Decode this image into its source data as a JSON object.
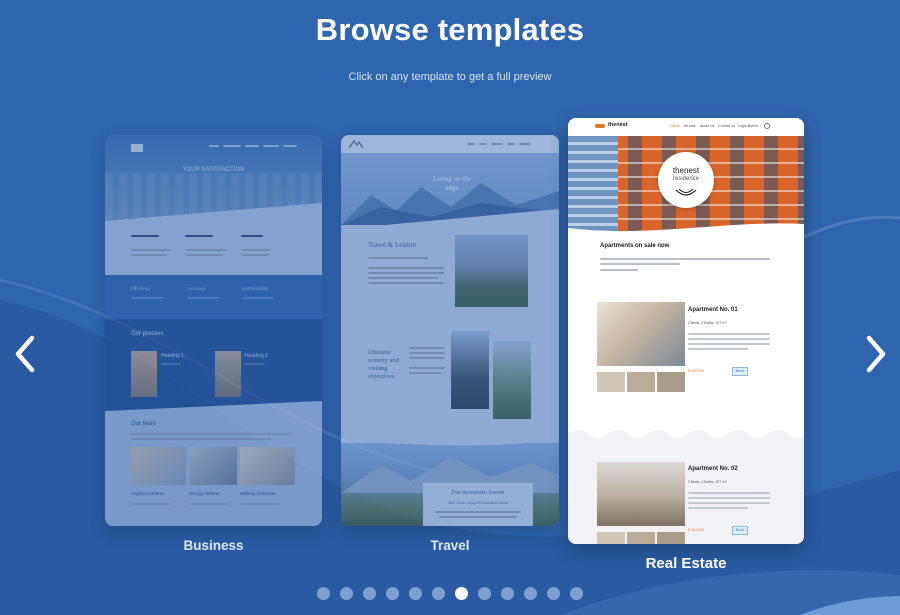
{
  "header": {
    "title": "Browse templates",
    "subtitle": "Click on any template to get a full preview"
  },
  "colors": {
    "background": "#2f64ae",
    "accent": "#ffffff",
    "real_estate_orange": "#e07a2a"
  },
  "navigation": {
    "prev_icon": "chevron-left-icon",
    "next_icon": "chevron-right-icon"
  },
  "templates": [
    {
      "label": "Business",
      "preview": {
        "hero_text": "YOUR SATISFACTION",
        "section_our_process": "Our process",
        "process_items": [
          "Heading 1",
          "Heading 2"
        ],
        "section_our_team": "Our team",
        "team_members": [
          "Sophia Cameron",
          "George Nelson",
          "Melissa Simmons"
        ],
        "info_row": [
          "Efficiency",
          "Accuracy",
          "Sustainability"
        ]
      }
    },
    {
      "label": "Travel",
      "preview": {
        "hero_text": "Living on the edge",
        "section_1": "Travel & Leisure",
        "section_2": "Ultimate scenery and visiting objectives",
        "section_3": "For mountain lovers",
        "section_3_sub": "Hike, climb, enjoy the snowfield views!"
      }
    },
    {
      "label": "Real Estate",
      "preview": {
        "brand": "thenest",
        "logo_title": "thenest",
        "logo_sub": "residence",
        "nav_items": [
          "Home",
          "All sale",
          "About us",
          "Contact us",
          "Login Button"
        ],
        "section_title": "Apartments on sale now",
        "apartments": [
          {
            "title": "Apartment No. 01",
            "specs": "2 Beds, 2 Baths, 107 m²",
            "price": "$ 349 000",
            "button": "Book"
          },
          {
            "title": "Apartment No. 02",
            "specs": "2 Beds, 2 Baths, 207 m²",
            "price": "$ 454 000",
            "button": "Book"
          }
        ]
      }
    }
  ],
  "pagination": {
    "count": 12,
    "active_index": 6
  }
}
